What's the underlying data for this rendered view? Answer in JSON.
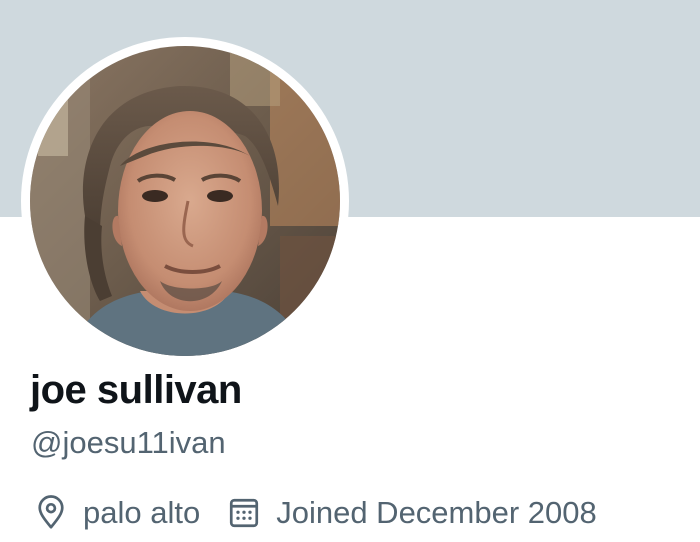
{
  "profile": {
    "display_name": "joe sullivan",
    "handle": "@joesu11ivan",
    "location": "palo alto",
    "joined": "Joined December 2008",
    "location_icon": "location-pin-icon",
    "joined_icon": "calendar-icon"
  },
  "colors": {
    "banner": "#cfd9de",
    "name_text": "#0f1419",
    "secondary_text": "#536471"
  }
}
